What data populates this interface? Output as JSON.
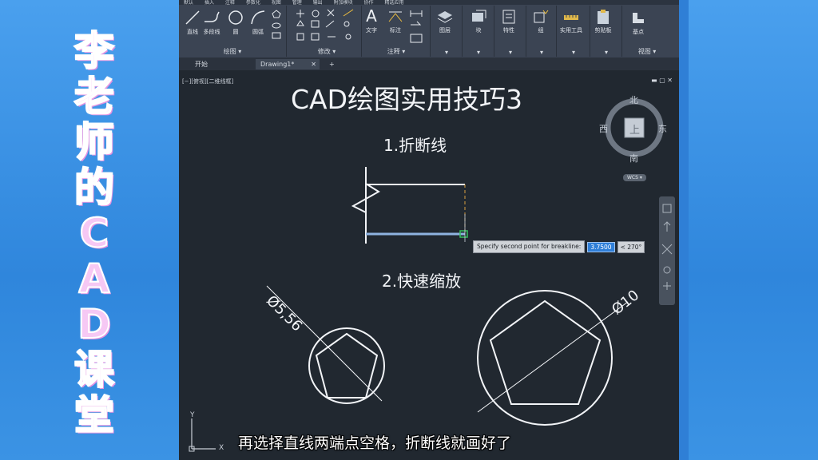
{
  "brand": {
    "chars": [
      "李",
      "老",
      "师",
      "的",
      "C",
      "A",
      "D",
      "课",
      "堂"
    ]
  },
  "ribbon": {
    "tabs": [
      "默认",
      "插入",
      "注释",
      "参数化",
      "视图",
      "管理",
      "输出",
      "附加模块",
      "协作",
      "精选应用"
    ],
    "draw_tools": {
      "line": "直线",
      "polyline": "多段线",
      "circle": "圆",
      "arc": "圆弧"
    },
    "annotation_tools": {
      "text": "文字",
      "dimension": "标注"
    },
    "panel_buttons": {
      "layers": "图层",
      "block": "块",
      "properties": "特性",
      "group": "组",
      "utilities": "实用工具",
      "clipboard": "剪贴板",
      "base": "基点"
    },
    "panel_titles": {
      "draw": "绘图 ▾",
      "modify": "修改 ▾",
      "annotation": "注释 ▾",
      "view": "视图 ▾"
    }
  },
  "doc_tabs": {
    "start": "开始",
    "drawing": "Drawing1*",
    "close": "✕",
    "add": "+"
  },
  "viewport": {
    "label": "[−][俯视][二维线框]",
    "window_controls": "▬ ▢ ✕",
    "title": "CAD绘图实用技巧3",
    "section1": "1.折断线",
    "section2": "2.快速缩放",
    "dim_small": "Ø5,56",
    "dim_large": "Ø10",
    "command_prompt": "Specify second point for breakline:",
    "command_value": "3.7500",
    "command_angle": "< 270°",
    "viewcube": {
      "north": "北",
      "south": "南",
      "east": "东",
      "west": "西",
      "top": "上",
      "wcs": "WCS ▾"
    },
    "ucs_x": "X",
    "ucs_y": "Y"
  },
  "subtitle": "再选择直线两端点空格，折断线就画好了",
  "colors": {
    "canvas": "#212830",
    "ribbon": "#3b4453",
    "desktop": "#3a8fe0",
    "brand_text": "#f6c8f4",
    "command_value": "#2f7fd8"
  }
}
